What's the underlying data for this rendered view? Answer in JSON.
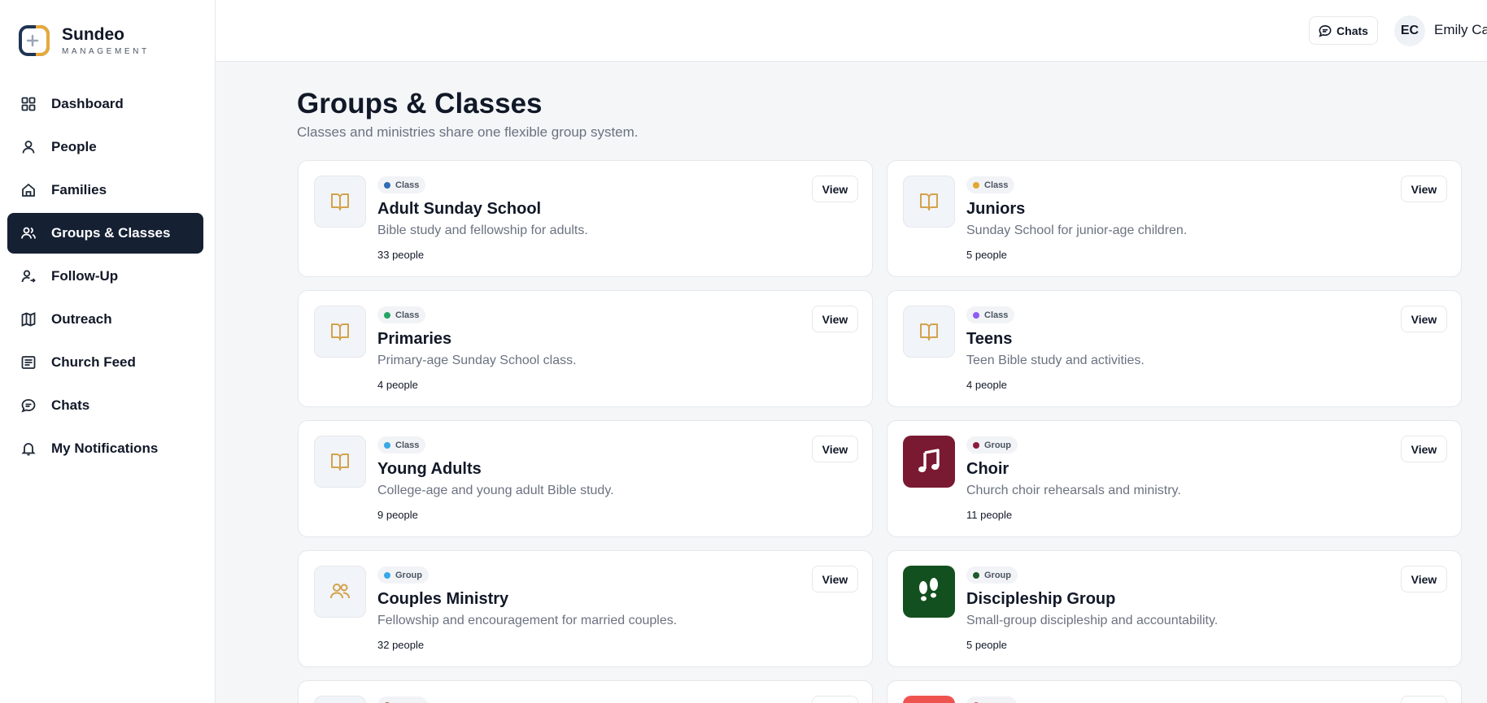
{
  "brand": {
    "name": "Sundeo",
    "sub": "MANAGEMENT"
  },
  "sidebar": {
    "items": [
      {
        "label": "Dashboard",
        "icon": "grid-icon"
      },
      {
        "label": "People",
        "icon": "user-icon"
      },
      {
        "label": "Families",
        "icon": "house-icon"
      },
      {
        "label": "Groups & Classes",
        "icon": "users-icon",
        "active": true
      },
      {
        "label": "Follow-Up",
        "icon": "user-arrow-icon"
      },
      {
        "label": "Outreach",
        "icon": "map-icon"
      },
      {
        "label": "Church Feed",
        "icon": "newspaper-icon"
      },
      {
        "label": "Chats",
        "icon": "chat-icon"
      },
      {
        "label": "My Notifications",
        "icon": "bell-icon"
      }
    ]
  },
  "topbar": {
    "chats_label": "Chats",
    "avatar_initials": "EC",
    "user_name": "Emily Ca"
  },
  "page": {
    "title": "Groups & Classes",
    "subtitle": "Classes and ministries share one flexible group system."
  },
  "colors": {
    "sidebar_active": "#152033",
    "accent_gold": "#d4a24c",
    "choir": "#7a1a32",
    "discipleship": "#13501f"
  },
  "cards": [
    {
      "type": "Class",
      "dot": "#2f6db5",
      "name": "Adult Sunday School",
      "desc": "Bible study and fellowship for adults.",
      "count": "33 people",
      "icon": "book-icon",
      "view": "View"
    },
    {
      "type": "Class",
      "dot": "#e0a82e",
      "name": "Juniors",
      "desc": "Sunday School for junior-age children.",
      "count": "5 people",
      "icon": "book-icon",
      "view": "View"
    },
    {
      "type": "Class",
      "dot": "#22a565",
      "name": "Primaries",
      "desc": "Primary-age Sunday School class.",
      "count": "4 people",
      "icon": "book-icon",
      "view": "View"
    },
    {
      "type": "Class",
      "dot": "#8b5cf6",
      "name": "Teens",
      "desc": "Teen Bible study and activities.",
      "count": "4 people",
      "icon": "book-icon",
      "view": "View"
    },
    {
      "type": "Class",
      "dot": "#38a8e8",
      "name": "Young Adults",
      "desc": "College-age and young adult Bible study.",
      "count": "9 people",
      "icon": "book-icon",
      "view": "View"
    },
    {
      "type": "Group",
      "dot": "#8a1d3d",
      "name": "Choir",
      "desc": "Church choir rehearsals and ministry.",
      "count": "11 people",
      "icon": "music-note-icon",
      "view": "View"
    },
    {
      "type": "Group",
      "dot": "#38a8e8",
      "name": "Couples Ministry",
      "desc": "Fellowship and encouragement for married couples.",
      "count": "32 people",
      "icon": "users-icon",
      "view": "View"
    },
    {
      "type": "Group",
      "dot": "#1d5a2a",
      "name": "Discipleship Group",
      "desc": "Small-group discipleship and accountability.",
      "count": "5 people",
      "icon": "footprints-icon",
      "view": "View"
    }
  ]
}
